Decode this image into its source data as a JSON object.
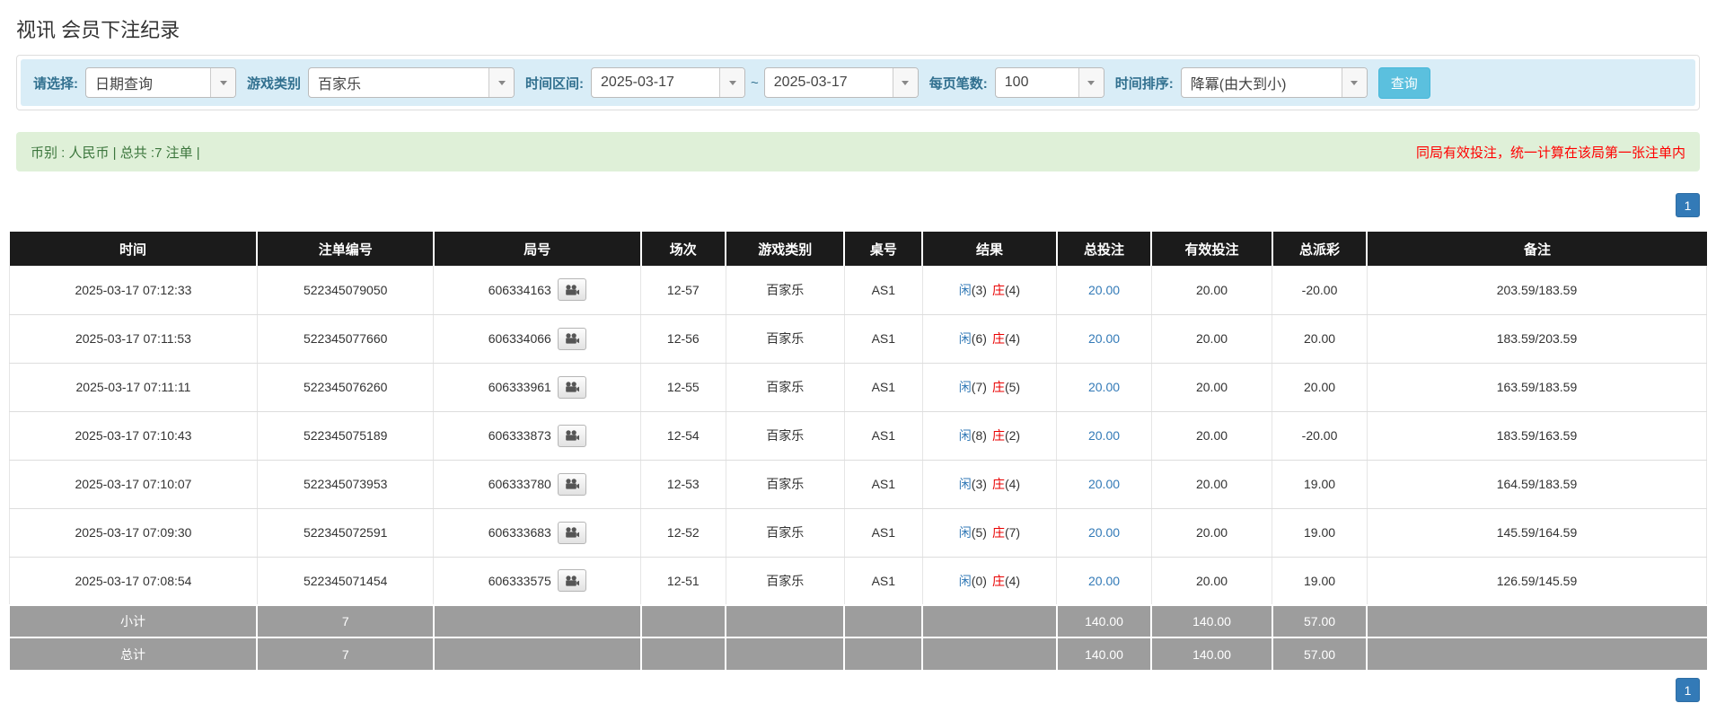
{
  "page": {
    "title": "视讯 会员下注纪录"
  },
  "colors": {
    "accent-blue": "#337ab7",
    "negative-red": "#e90000",
    "filter-bg": "#d9edf7",
    "filter-label": "#31708f",
    "summary-bg": "#dff0d8",
    "summary-text": "#3c763d",
    "note-red": "#ff0000",
    "header-bg": "#1b1b1b",
    "subtotal-bg": "#9d9d9d",
    "button-blue": "#5bc0de"
  },
  "filters": {
    "select_label": "请选择:",
    "select_value": "日期查询",
    "game_type_label": "游戏类别",
    "game_type_value": "百家乐",
    "time_range_label": "时间区间:",
    "date_from": "2025-03-17",
    "tilde": "~",
    "date_to": "2025-03-17",
    "page_size_label": "每页笔数:",
    "page_size_value": "100",
    "sort_label": "时间排序:",
    "sort_value": "降冪(由大到小)",
    "search_button": "查询"
  },
  "summary_bar": {
    "left_text": "币别 : 人民币 | 总共 :7 注单 |",
    "right_note": "同局有效投注，统一计算在该局第一张注单内"
  },
  "pagination": {
    "page": "1"
  },
  "table": {
    "headers": [
      "时间",
      "注单编号",
      "局号",
      "场次",
      "游戏类别",
      "桌号",
      "结果",
      "总投注",
      "有效投注",
      "总派彩",
      "备注"
    ],
    "result_player_label": "闲",
    "result_banker_label": "庄",
    "rows": [
      {
        "time": "2025-03-17 07:12:33",
        "bet_id": "522345079050",
        "round_id": "606334163",
        "session": "12-57",
        "game": "百家乐",
        "table_no": "AS1",
        "player_num": "3",
        "banker_num": "4",
        "total_bet": "20.00",
        "valid_bet": "20.00",
        "payout": "-20.00",
        "remark": "203.59/183.59"
      },
      {
        "time": "2025-03-17 07:11:53",
        "bet_id": "522345077660",
        "round_id": "606334066",
        "session": "12-56",
        "game": "百家乐",
        "table_no": "AS1",
        "player_num": "6",
        "banker_num": "4",
        "total_bet": "20.00",
        "valid_bet": "20.00",
        "payout": "20.00",
        "remark": "183.59/203.59"
      },
      {
        "time": "2025-03-17 07:11:11",
        "bet_id": "522345076260",
        "round_id": "606333961",
        "session": "12-55",
        "game": "百家乐",
        "table_no": "AS1",
        "player_num": "7",
        "banker_num": "5",
        "total_bet": "20.00",
        "valid_bet": "20.00",
        "payout": "20.00",
        "remark": "163.59/183.59"
      },
      {
        "time": "2025-03-17 07:10:43",
        "bet_id": "522345075189",
        "round_id": "606333873",
        "session": "12-54",
        "game": "百家乐",
        "table_no": "AS1",
        "player_num": "8",
        "banker_num": "2",
        "total_bet": "20.00",
        "valid_bet": "20.00",
        "payout": "-20.00",
        "remark": "183.59/163.59"
      },
      {
        "time": "2025-03-17 07:10:07",
        "bet_id": "522345073953",
        "round_id": "606333780",
        "session": "12-53",
        "game": "百家乐",
        "table_no": "AS1",
        "player_num": "3",
        "banker_num": "4",
        "total_bet": "20.00",
        "valid_bet": "20.00",
        "payout": "19.00",
        "remark": "164.59/183.59"
      },
      {
        "time": "2025-03-17 07:09:30",
        "bet_id": "522345072591",
        "round_id": "606333683",
        "session": "12-52",
        "game": "百家乐",
        "table_no": "AS1",
        "player_num": "5",
        "banker_num": "7",
        "total_bet": "20.00",
        "valid_bet": "20.00",
        "payout": "19.00",
        "remark": "145.59/164.59"
      },
      {
        "time": "2025-03-17 07:08:54",
        "bet_id": "522345071454",
        "round_id": "606333575",
        "session": "12-51",
        "game": "百家乐",
        "table_no": "AS1",
        "player_num": "0",
        "banker_num": "4",
        "total_bet": "20.00",
        "valid_bet": "20.00",
        "payout": "19.00",
        "remark": "126.59/145.59"
      }
    ],
    "subtotal": {
      "label": "小计",
      "count": "7",
      "total_bet": "140.00",
      "valid_bet": "140.00",
      "payout": "57.00"
    },
    "total": {
      "label": "总计",
      "count": "7",
      "total_bet": "140.00",
      "valid_bet": "140.00",
      "payout": "57.00"
    }
  }
}
